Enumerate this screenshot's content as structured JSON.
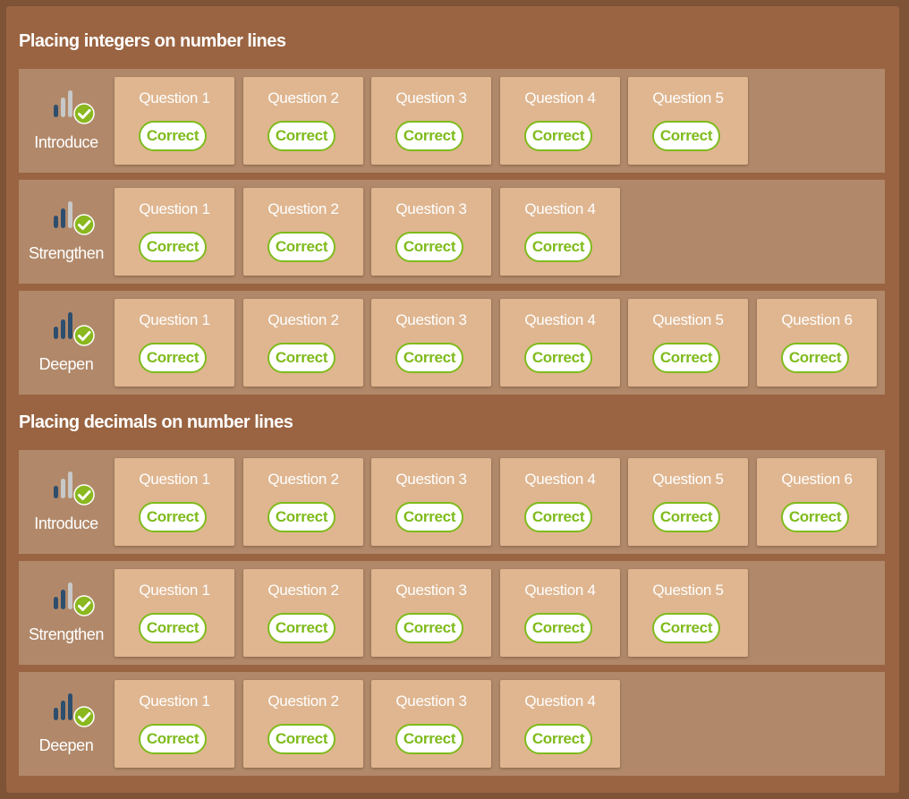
{
  "colors": {
    "frame": "#7e5336",
    "panel": "#9a6442",
    "row": "#b1896a",
    "card": "#dfb690",
    "correct": "#7fbb1c",
    "bar_dark": "#2e4e6e",
    "bar_light": "#c8c8c8"
  },
  "sections": [
    {
      "title": "Placing integers on number lines",
      "levels": [
        {
          "name": "Introduce",
          "level": 1,
          "icon": "difficulty-bars-check-icon",
          "questions": [
            {
              "label": "Question 1",
              "status": "Correct"
            },
            {
              "label": "Question 2",
              "status": "Correct"
            },
            {
              "label": "Question 3",
              "status": "Correct"
            },
            {
              "label": "Question 4",
              "status": "Correct"
            },
            {
              "label": "Question 5",
              "status": "Correct"
            }
          ]
        },
        {
          "name": "Strengthen",
          "level": 2,
          "icon": "difficulty-bars-check-icon",
          "questions": [
            {
              "label": "Question 1",
              "status": "Correct"
            },
            {
              "label": "Question 2",
              "status": "Correct"
            },
            {
              "label": "Question 3",
              "status": "Correct"
            },
            {
              "label": "Question 4",
              "status": "Correct"
            }
          ]
        },
        {
          "name": "Deepen",
          "level": 3,
          "icon": "difficulty-bars-check-icon",
          "questions": [
            {
              "label": "Question 1",
              "status": "Correct"
            },
            {
              "label": "Question 2",
              "status": "Correct"
            },
            {
              "label": "Question 3",
              "status": "Correct"
            },
            {
              "label": "Question 4",
              "status": "Correct"
            },
            {
              "label": "Question 5",
              "status": "Correct"
            },
            {
              "label": "Question 6",
              "status": "Correct"
            }
          ]
        }
      ]
    },
    {
      "title": "Placing decimals on number lines",
      "levels": [
        {
          "name": "Introduce",
          "level": 1,
          "icon": "difficulty-bars-check-icon",
          "questions": [
            {
              "label": "Question 1",
              "status": "Correct"
            },
            {
              "label": "Question 2",
              "status": "Correct"
            },
            {
              "label": "Question 3",
              "status": "Correct"
            },
            {
              "label": "Question 4",
              "status": "Correct"
            },
            {
              "label": "Question 5",
              "status": "Correct"
            },
            {
              "label": "Question 6",
              "status": "Correct"
            }
          ]
        },
        {
          "name": "Strengthen",
          "level": 2,
          "icon": "difficulty-bars-check-icon",
          "questions": [
            {
              "label": "Question 1",
              "status": "Correct"
            },
            {
              "label": "Question 2",
              "status": "Correct"
            },
            {
              "label": "Question 3",
              "status": "Correct"
            },
            {
              "label": "Question 4",
              "status": "Correct"
            },
            {
              "label": "Question 5",
              "status": "Correct"
            }
          ]
        },
        {
          "name": "Deepen",
          "level": 3,
          "icon": "difficulty-bars-check-icon",
          "questions": [
            {
              "label": "Question 1",
              "status": "Correct"
            },
            {
              "label": "Question 2",
              "status": "Correct"
            },
            {
              "label": "Question 3",
              "status": "Correct"
            },
            {
              "label": "Question 4",
              "status": "Correct"
            }
          ]
        }
      ]
    }
  ]
}
